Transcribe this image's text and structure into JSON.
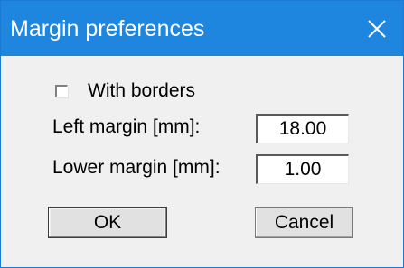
{
  "window": {
    "title": "Margin preferences",
    "close_icon": "close-icon",
    "colors": {
      "titlebar": "#1f86e0",
      "title_text": "#ffffff",
      "body": "#f0f0f0"
    }
  },
  "options": {
    "with_borders_label": "With borders",
    "with_borders_checked": false
  },
  "fields": {
    "left_margin_label": "Left margin [mm]:",
    "left_margin_value": "18.00",
    "lower_margin_label": "Lower margin [mm]:",
    "lower_margin_value": "1.00"
  },
  "buttons": {
    "ok_label": "OK",
    "cancel_label": "Cancel"
  }
}
